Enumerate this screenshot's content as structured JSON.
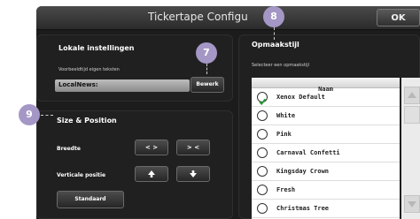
{
  "window": {
    "title": "Tickertape Configu",
    "ok_label": "OK"
  },
  "local": {
    "heading": "Lokale instellingen",
    "preview_label": "Voorbeeldtijd eigen teksten",
    "text_value": "LocalNews:",
    "edit_label": "Bewerk"
  },
  "size": {
    "heading": "Size & Position",
    "width_label": "Breedte",
    "vpos_label": "Verticale positie",
    "widen": "< >",
    "narrow": "> <",
    "up_icon": "arrow-up",
    "down_icon": "arrow-down",
    "default_label": "Standaard"
  },
  "style": {
    "heading": "Opmaakstijl",
    "select_label": "Selecteer een opmaakstijl",
    "column_header": "Naam",
    "items": [
      {
        "name": "Xenox Default",
        "selected": true
      },
      {
        "name": "White",
        "selected": false
      },
      {
        "name": "Pink",
        "selected": false
      },
      {
        "name": "Carnaval Confetti",
        "selected": false
      },
      {
        "name": "Kingsday Crown",
        "selected": false
      },
      {
        "name": "Fresh",
        "selected": false
      },
      {
        "name": "Christmas Tree",
        "selected": false
      }
    ]
  },
  "markers": {
    "m7": "7",
    "m8": "8",
    "m9": "9"
  },
  "colors": {
    "marker": "#a497c6",
    "check": "#2e9a3a",
    "panel": "#1e1e1e"
  }
}
